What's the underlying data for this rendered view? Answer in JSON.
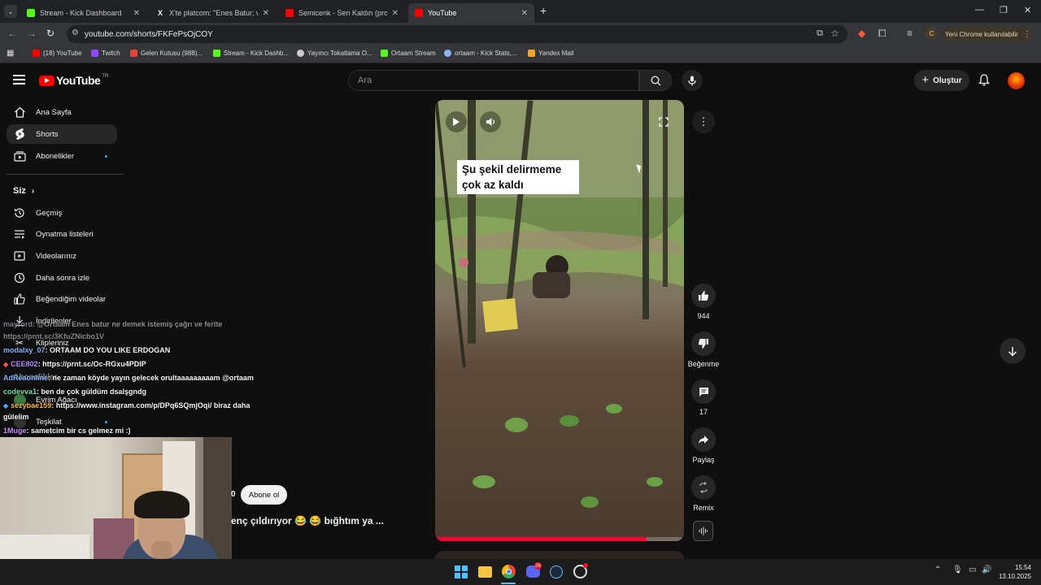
{
  "browser": {
    "tabs": [
      {
        "title": "Stream - Kick Dashboard",
        "color": "#53fc18"
      },
      {
        "title": "X'te platcom: \"Enes Batur; wtch...",
        "color": "#ffffff"
      },
      {
        "title": "Semicenk - Sen Kaldın (prod. b...",
        "color": "#ff0000"
      },
      {
        "title": "YouTube",
        "color": "#ff0000"
      }
    ],
    "url": "youtube.com/shorts/FKFePsOjCOY",
    "profile_button": "Yeni Chrome kullanılabilir",
    "profile_initial": "C",
    "bookmarks": [
      {
        "label": "(18) YouTube",
        "color": "#ff0000"
      },
      {
        "label": "Twitch",
        "color": "#9146ff"
      },
      {
        "label": "Gelen Kutusu (988)...",
        "color": "#ea4335"
      },
      {
        "label": "Stream - Kick Dashb...",
        "color": "#53fc18"
      },
      {
        "label": "Yayıncı Tokatlama O...",
        "color": "#cccccc"
      },
      {
        "label": "Ortaam Stream",
        "color": "#53fc18"
      },
      {
        "label": "ortaam - Kick Stats,...",
        "color": "#8ab4f8"
      },
      {
        "label": "Yandex Mail",
        "color": "#f5a623"
      }
    ]
  },
  "youtube": {
    "logo_text": "YouTube",
    "logo_region": "TR",
    "search_placeholder": "Ara",
    "create_label": "Oluştur",
    "sidebar": {
      "main": [
        {
          "label": "Ana Sayfa",
          "icon": "home-icon"
        },
        {
          "label": "Shorts",
          "icon": "shorts-icon",
          "selected": true
        },
        {
          "label": "Abonelikler",
          "icon": "subscriptions-icon",
          "dot": true
        }
      ],
      "you_header": "Siz",
      "you": [
        {
          "label": "Geçmiş",
          "icon": "history-icon"
        },
        {
          "label": "Oynatma listeleri",
          "icon": "playlist-icon"
        },
        {
          "label": "Videolarınız",
          "icon": "videos-icon"
        },
        {
          "label": "Daha sonra izle",
          "icon": "clock-icon"
        },
        {
          "label": "Beğendiğim videolar",
          "icon": "like-icon"
        },
        {
          "label": "İndirilenler",
          "icon": "download-icon"
        },
        {
          "label": "Klipleriniz",
          "icon": "scissors-icon"
        }
      ],
      "subs_header": "Abonelikler",
      "subs": [
        {
          "label": "Evrim Ağacı"
        },
        {
          "label": "Teşkilat"
        }
      ]
    },
    "short": {
      "caption_line1": "Şu şekil delirmeme",
      "caption_line2": "çok az kaldı",
      "like_count": "944",
      "dislike_label": "Beğenme",
      "comment_count": "17",
      "share_label": "Paylaş",
      "remix_label": "Remix",
      "subscribe_label": "Abone ol",
      "subscriber_fragment": "0",
      "title_fragment": "enç çıldırıyor 😂 😂 bığhtım ya ...",
      "progress": 0.85
    }
  },
  "chat": [
    {
      "user": "mayrord",
      "user_color": "#9aa4b8",
      "text": ": @Ortaam Enes batur ne demek istemiş çağrı ve ferite"
    },
    {
      "user": "",
      "user_color": "#cccccc",
      "text": "https://prnt.sc/3KfuZNicbo1V"
    },
    {
      "user": "modalxy_07",
      "user_color": "#7fb3ff",
      "text": ": ORTAAM DO YOU LIKE ERDOGAN"
    },
    {
      "user": "CEE802",
      "user_color": "#b48cff",
      "text": ": https://prnt.sc/Oc-RGxu4PDIP"
    },
    {
      "user": "AdReaonline",
      "user_color": "#7fb3ff",
      "text": ": ne zaman köyde yayın gelecek orultaaaaaaaaam @ortaam"
    },
    {
      "user": "codevva1",
      "user_color": "#6fe0a0",
      "text": ": ben de çok güldüm dsalşgndg"
    },
    {
      "user": "sezybae159",
      "user_color": "#ffb347",
      "text": ": https://www.instagram.com/p/DPq6SQmjOqi/ biraz daha"
    },
    {
      "user": "",
      "user_color": "#cccccc",
      "text": "gülelim"
    },
    {
      "user": "1Muge",
      "user_color": "#c58cff",
      "text": ": sametcim bir cs gelmez mi :)"
    }
  ],
  "taskbar": {
    "time": "15:54",
    "date": "13.10.2025",
    "discord_badge": "26"
  }
}
